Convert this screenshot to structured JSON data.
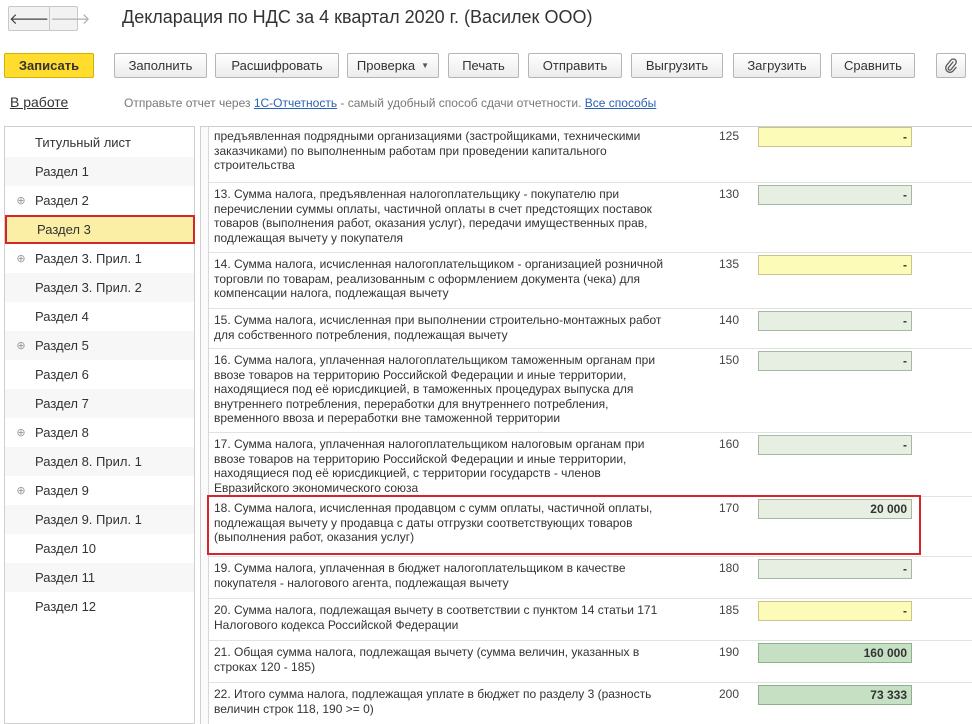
{
  "window": {
    "title": "Декларация по НДС за 4 квартал 2020 г. (Василек ООО)",
    "back_glyph": "🡐",
    "forward_glyph": "🡒"
  },
  "toolbar": {
    "save": "Записать",
    "fill": "Заполнить",
    "decode": "Расшифровать",
    "check": "Проверка",
    "print": "Печать",
    "send": "Отправить",
    "export": "Выгрузить",
    "import": "Загрузить",
    "compare": "Сравнить",
    "attach_icon": "paperclip-icon"
  },
  "status": {
    "state": "В работе",
    "hint_before": "Отправьте отчет через ",
    "hint_link": "1С-Отчетность",
    "hint_after": " - самый удобный способ сдачи отчетности. ",
    "hint_all": "Все способы"
  },
  "sidebar": {
    "items": [
      {
        "label": "Титульный лист",
        "expandable": false
      },
      {
        "label": "Раздел 1",
        "expandable": false
      },
      {
        "label": "Раздел 2",
        "expandable": true
      },
      {
        "label": "Раздел 3",
        "expandable": false,
        "selected": true
      },
      {
        "label": "Раздел 3. Прил. 1",
        "expandable": true
      },
      {
        "label": "Раздел 3. Прил. 2",
        "expandable": false
      },
      {
        "label": "Раздел 4",
        "expandable": false
      },
      {
        "label": "Раздел 5",
        "expandable": true
      },
      {
        "label": "Раздел 6",
        "expandable": false
      },
      {
        "label": "Раздел 7",
        "expandable": false
      },
      {
        "label": "Раздел 8",
        "expandable": true
      },
      {
        "label": "Раздел 8. Прил. 1",
        "expandable": false
      },
      {
        "label": "Раздел 9",
        "expandable": true
      },
      {
        "label": "Раздел 9. Прил. 1",
        "expandable": false
      },
      {
        "label": "Раздел 10",
        "expandable": false
      },
      {
        "label": "Раздел 11",
        "expandable": false
      },
      {
        "label": "Раздел 12",
        "expandable": false
      }
    ]
  },
  "rows": [
    {
      "text": "предъявленная подрядными организациями (застройщиками, техническими заказчиками) по выполненным работам при проведении капитального строительства",
      "code": "125",
      "value": "-",
      "style": "yellow"
    },
    {
      "text": "13. Сумма налога, предъявленная налогоплательщику - покупателю при перечислении суммы оплаты, частичной оплаты в счет предстоящих поставок товаров (выполнения работ, оказания услуг), передачи имущественных прав, подлежащая вычету у покупателя",
      "code": "130",
      "value": "-",
      "style": "green"
    },
    {
      "text": "14. Сумма налога, исчисленная налогоплательщиком - организацией розничной торговли по товарам, реализованным с оформлением документа (чека) для компенсации налога, подлежащая вычету",
      "code": "135",
      "value": "-",
      "style": "yellow"
    },
    {
      "text": "15. Сумма налога, исчисленная при выполнении строительно-монтажных работ для собственного потребления, подлежащая вычету",
      "code": "140",
      "value": "-",
      "style": "green"
    },
    {
      "text": "16. Сумма налога, уплаченная налогоплательщиком таможенным органам при ввозе товаров на территорию Российской Федерации и иные территории, находящиеся под её юрисдикцией, в таможенных процедурах выпуска для внутреннего потребления, переработки для внутреннего потребления, временного ввоза и переработки вне таможенной территории",
      "code": "150",
      "value": "-",
      "style": "green"
    },
    {
      "text": "17. Сумма налога, уплаченная налогоплательщиком налоговым органам при ввозе товаров на территорию Российской Федерации и иные территории, находящиеся под её юрисдикцией, с территории государств - членов Евразийского экономического союза",
      "code": "160",
      "value": "-",
      "style": "green"
    },
    {
      "text": "18. Сумма налога, исчисленная продавцом с сумм оплаты, частичной оплаты, подлежащая вычету у продавца с даты отгрузки соответствующих товаров (выполнения работ, оказания услуг)",
      "code": "170",
      "value": "20 000",
      "style": "green"
    },
    {
      "text": "19. Сумма налога, уплаченная в бюджет налогоплательщиком в качестве покупателя - налогового агента, подлежащая вычету",
      "code": "180",
      "value": "-",
      "style": "green"
    },
    {
      "text": "20. Сумма налога, подлежащая вычету в соответствии с пунктом 14 статьи 171 Налогового кодекса Российской Федерации",
      "code": "185",
      "value": "-",
      "style": "yellow"
    },
    {
      "text": "21. Общая сумма налога, подлежащая вычету (сумма величин, указанных в строках 120 - 185)",
      "code": "190",
      "value": "160 000",
      "style": "dgreen"
    },
    {
      "text": "22. Итого сумма налога, подлежащая уплате в бюджет по разделу 3 (разность величин строк 118, 190 >= 0)",
      "code": "200",
      "value": "73 333",
      "style": "dgreen"
    }
  ]
}
